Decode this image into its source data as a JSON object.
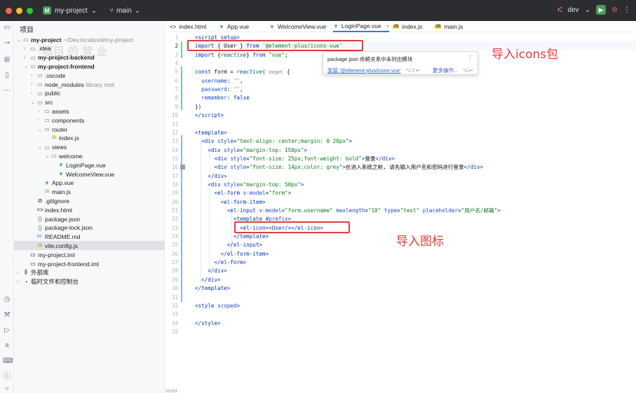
{
  "titlebar": {
    "project_badge": "M",
    "project_name": "my-project",
    "branch": "main",
    "right_label": "dev",
    "colors": {
      "close": "#ff5f57",
      "minimize": "#febc2e",
      "maximize": "#28c840"
    }
  },
  "project_panel": {
    "title": "项目",
    "watermark": "项目 的 营 业",
    "tree": [
      {
        "label": "my-project",
        "muted": "~/Dev.localized/my-project",
        "icon": "folder-icon",
        "bold": true,
        "expanded": true
      },
      {
        "label": ".idea",
        "icon": "folder-icon"
      },
      {
        "label": "my-project-backend",
        "icon": "folder-icon",
        "bold": true
      },
      {
        "label": "my-project-frontend",
        "icon": "folder-icon",
        "bold": true,
        "expanded": true
      },
      {
        "label": ".vscode",
        "icon": "folder-icon"
      },
      {
        "label": "node_modules",
        "muted": "library root",
        "icon": "folder-icon"
      },
      {
        "label": "public",
        "icon": "folder-icon"
      },
      {
        "label": "src",
        "icon": "folder-icon",
        "expanded": true
      },
      {
        "label": "assets",
        "icon": "folder-icon"
      },
      {
        "label": "components",
        "icon": "folder-icon"
      },
      {
        "label": "router",
        "icon": "folder-icon",
        "expanded": true
      },
      {
        "label": "index.js",
        "icon": "js-file-icon"
      },
      {
        "label": "views",
        "icon": "folder-icon",
        "expanded": true
      },
      {
        "label": "welcome",
        "icon": "folder-icon",
        "expanded": true
      },
      {
        "label": "LoginPage.vue",
        "icon": "vue-file-icon"
      },
      {
        "label": "WelcomeView.vue",
        "icon": "vue-file-icon"
      },
      {
        "label": "App.vue",
        "icon": "vue-file-icon"
      },
      {
        "label": "main.js",
        "icon": "js-file-icon"
      },
      {
        "label": ".gitignore",
        "icon": "gitignore-icon"
      },
      {
        "label": "index.html",
        "icon": "html-file-icon"
      },
      {
        "label": "package.json",
        "icon": "json-file-icon"
      },
      {
        "label": "package-lock.json",
        "icon": "json-file-icon"
      },
      {
        "label": "README.md",
        "icon": "md-file-icon"
      },
      {
        "label": "vite.config.js",
        "icon": "js-file-icon",
        "selected": true
      },
      {
        "label": "my-project.iml",
        "icon": "iml-file-icon"
      },
      {
        "label": "my-project-frontend.iml",
        "icon": "iml-file-icon"
      },
      {
        "label": "外部库",
        "icon": "library-icon"
      },
      {
        "label": "临时文件和控制台",
        "icon": "scratch-icon"
      }
    ]
  },
  "tabs": [
    {
      "label": "index.html",
      "icon": "html-file-icon"
    },
    {
      "label": "App.vue",
      "icon": "vue-file-icon"
    },
    {
      "label": "WelcomeView.vue",
      "icon": "vue-file-icon"
    },
    {
      "label": "LoginPage.vue",
      "icon": "vue-file-icon",
      "active": true
    },
    {
      "label": "index.js",
      "icon": "js-file-icon"
    },
    {
      "label": "main.js",
      "icon": "js-file-icon"
    }
  ],
  "editor": {
    "lines": [
      {
        "n": "1",
        "html": "<span class=\"tag\">&lt;script setup&gt;</span>"
      },
      {
        "n": "2",
        "html": "<span class=\"kw\">import</span> { User } <span class=\"kw\">from</span> <span class=\"str\">'@element-plus/icons-vue'</span>"
      },
      {
        "n": "3",
        "html": "<span class=\"kw\">import</span> {<span class=\"fn\">reactive</span>} <span class=\"kw\">from</span> <span class=\"str\">\"vue\"</span>;"
      },
      {
        "n": "4",
        "html": ""
      },
      {
        "n": "5",
        "html": "<span class=\"kw\">const</span> form = <span class=\"fn\">reactive</span>( <span class=\"hint\">target:</span> {"
      },
      {
        "n": "6",
        "html": "  <span class=\"attr\">username</span>: <span class=\"str\">''</span>,"
      },
      {
        "n": "7",
        "html": "  <span class=\"attr\">password</span>: <span class=\"str\">''</span>,"
      },
      {
        "n": "8",
        "html": "  <span class=\"attr\">remember</span>: <span class=\"kw\">false</span>"
      },
      {
        "n": "9",
        "html": "})"
      },
      {
        "n": "10",
        "html": "<span class=\"tag\">&lt;/script&gt;</span>"
      },
      {
        "n": "11",
        "html": ""
      },
      {
        "n": "12",
        "html": "<span class=\"tag\">&lt;template&gt;</span>"
      },
      {
        "n": "13",
        "html": "  <span class=\"tag\">&lt;div</span> <span class=\"attr\">style</span>=<span class=\"str\">\"text-align: center;margin: 0 20px\"</span><span class=\"tag\">&gt;</span>"
      },
      {
        "n": "14",
        "html": "    <span class=\"tag\">&lt;div</span> <span class=\"attr\">style</span>=<span class=\"str\">\"margin-top: 150px\"</span><span class=\"tag\">&gt;</span>"
      },
      {
        "n": "15",
        "html": "      <span class=\"tag\">&lt;div</span> <span class=\"attr\">style</span>=<span class=\"str\">\"font-size: 25px;font-weight: bold\"</span><span class=\"tag\">&gt;</span>登录<span class=\"tag\">&lt;/div&gt;</span>"
      },
      {
        "n": "16",
        "html": "      <span class=\"tag\">&lt;div</span> <span class=\"attr\">style</span>=<span class=\"str\">\"font-size: 14px;color: grey\"</span><span class=\"tag\">&gt;</span>在进入系统之前, 请先输入用户名和密码进行登录<span class=\"tag\">&lt;/div&gt;</span>"
      },
      {
        "n": "17",
        "html": "    <span class=\"tag\">&lt;/div&gt;</span>"
      },
      {
        "n": "18",
        "html": "    <span class=\"tag\">&lt;div</span> <span class=\"attr\">style</span>=<span class=\"str\">\"margin-top: 50px\"</span><span class=\"tag\">&gt;</span>"
      },
      {
        "n": "19",
        "html": "      <span class=\"tag\">&lt;el-form</span> <span class=\"attr\">v-model</span>=<span class=\"str\">\"form\"</span><span class=\"tag\">&gt;</span>"
      },
      {
        "n": "20",
        "html": "        <span class=\"tag\">&lt;el-form-item&gt;</span>"
      },
      {
        "n": "21",
        "html": "          <span class=\"tag\">&lt;el-input</span> <span class=\"attr\">v-model</span>=<span class=\"str\">\"form.username\"</span> <span class=\"attr\">maxlength</span>=<span class=\"str\">\"10\"</span> <span class=\"attr\">type</span>=<span class=\"str\">\"text\"</span> <span class=\"attr\">placeholder</span>=<span class=\"str\">\"用户名/邮箱\"</span><span class=\"tag\">&gt;</span>"
      },
      {
        "n": "22",
        "html": "            <span class=\"tag\">&lt;template</span> <span class=\"attr\">#prefix</span><span class=\"tag\">&gt;</span>"
      },
      {
        "n": "23",
        "html": "              <span class=\"tag\">&lt;el-icon&gt;&lt;User/&gt;&lt;/el-icon&gt;</span>"
      },
      {
        "n": "24",
        "html": "            <span class=\"tag\">&lt;/template&gt;</span>"
      },
      {
        "n": "25",
        "html": "          <span class=\"tag\">&lt;/el-input&gt;</span>"
      },
      {
        "n": "26",
        "html": "        <span class=\"tag\">&lt;/el-form-item&gt;</span>"
      },
      {
        "n": "27",
        "html": "      <span class=\"tag\">&lt;/el-form&gt;</span>"
      },
      {
        "n": "28",
        "html": "    <span class=\"tag\">&lt;/div&gt;</span>"
      },
      {
        "n": "29",
        "html": "  <span class=\"tag\">&lt;/div&gt;</span>"
      },
      {
        "n": "30",
        "html": "<span class=\"tag\">&lt;/template&gt;</span>"
      },
      {
        "n": "31",
        "html": ""
      },
      {
        "n": "32",
        "html": "<span class=\"tag\">&lt;style</span> <span class=\"attr\">scoped</span><span class=\"tag\">&gt;</span>"
      },
      {
        "n": "33",
        "html": ""
      },
      {
        "n": "34",
        "html": "<span class=\"tag\">&lt;/style&gt;</span>"
      },
      {
        "n": "35",
        "html": ""
      }
    ]
  },
  "popup": {
    "message": "package.json 依赖关系中未列出模块",
    "action": "安装 '@element-plus/icons-vue'",
    "action_shortcut": "⌥⇧↩",
    "more_label": "更多操作...",
    "more_shortcut": "⌥↩"
  },
  "annotations": {
    "import_icons": "导入icons包",
    "import_icon": "导入图标"
  },
  "status_text": "script"
}
